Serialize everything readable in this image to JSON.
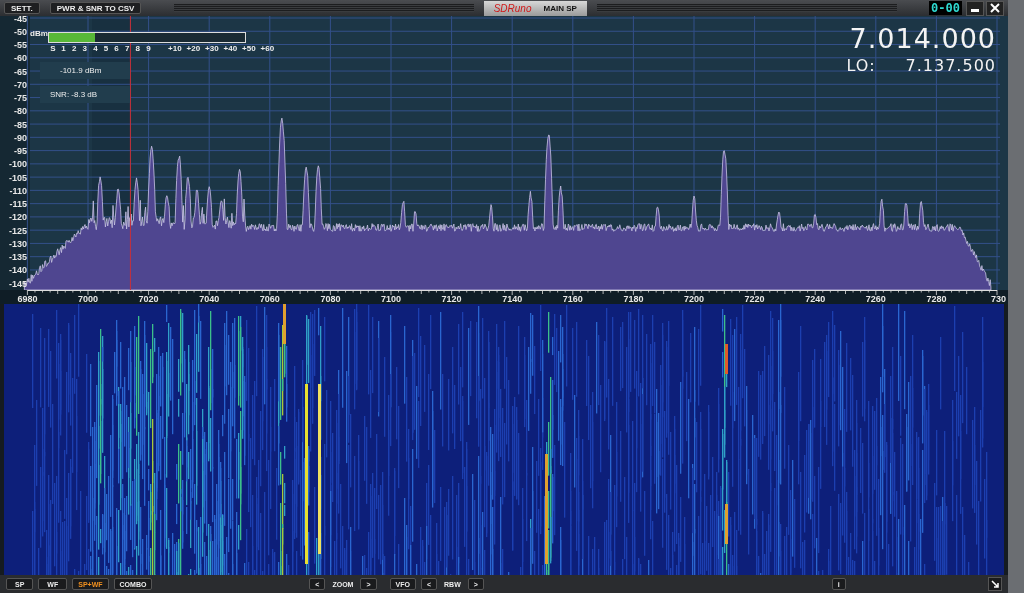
{
  "top_bar": {
    "buttons": [
      {
        "label": "SETT."
      },
      {
        "label": "PWR & SNR TO CSV"
      }
    ],
    "title_tab": {
      "logo": "SDRuno",
      "label": "MAIN SP"
    },
    "counter": "0-00"
  },
  "spectrum": {
    "unit": "dBm",
    "y_axis_labels": [
      "-45",
      "-50",
      "-55",
      "-60",
      "-65",
      "-70",
      "-75",
      "-80",
      "-85",
      "-90",
      "-95",
      "-100",
      "-105",
      "-110",
      "-115",
      "-120",
      "-125",
      "-130",
      "-135",
      "-140",
      "-145"
    ],
    "x_axis_labels": [
      "6980",
      "7000",
      "7020",
      "7040",
      "7060",
      "7080",
      "7100",
      "7120",
      "7140",
      "7160",
      "7180",
      "7200",
      "7220",
      "7240",
      "7260",
      "7280",
      "730"
    ],
    "s_meter": {
      "labels": [
        "S",
        "1",
        "2",
        "3",
        "4",
        "5",
        "6",
        "7",
        "8",
        "9",
        "+10",
        "+20",
        "+30",
        "+40",
        "+50",
        "+60"
      ],
      "level": 0.235
    },
    "signal_power": "-101.9 dBm",
    "snr": "SNR: -8.3 dB",
    "frequency": "7.014.000",
    "lo": {
      "label": "LO:",
      "value": "7.137.500"
    }
  },
  "bottom_bar": {
    "view_buttons": [
      {
        "label": "SP",
        "selected": false
      },
      {
        "label": "WF",
        "selected": false
      },
      {
        "label": "SP+WF",
        "selected": true
      },
      {
        "label": "COMBO",
        "selected": false
      }
    ],
    "zoom": {
      "prev": "<",
      "label": "ZOOM",
      "next": ">"
    },
    "vfo": "VFO",
    "rbw": {
      "prev": "<",
      "label": "RBW",
      "next": ">"
    },
    "info": "i"
  }
}
